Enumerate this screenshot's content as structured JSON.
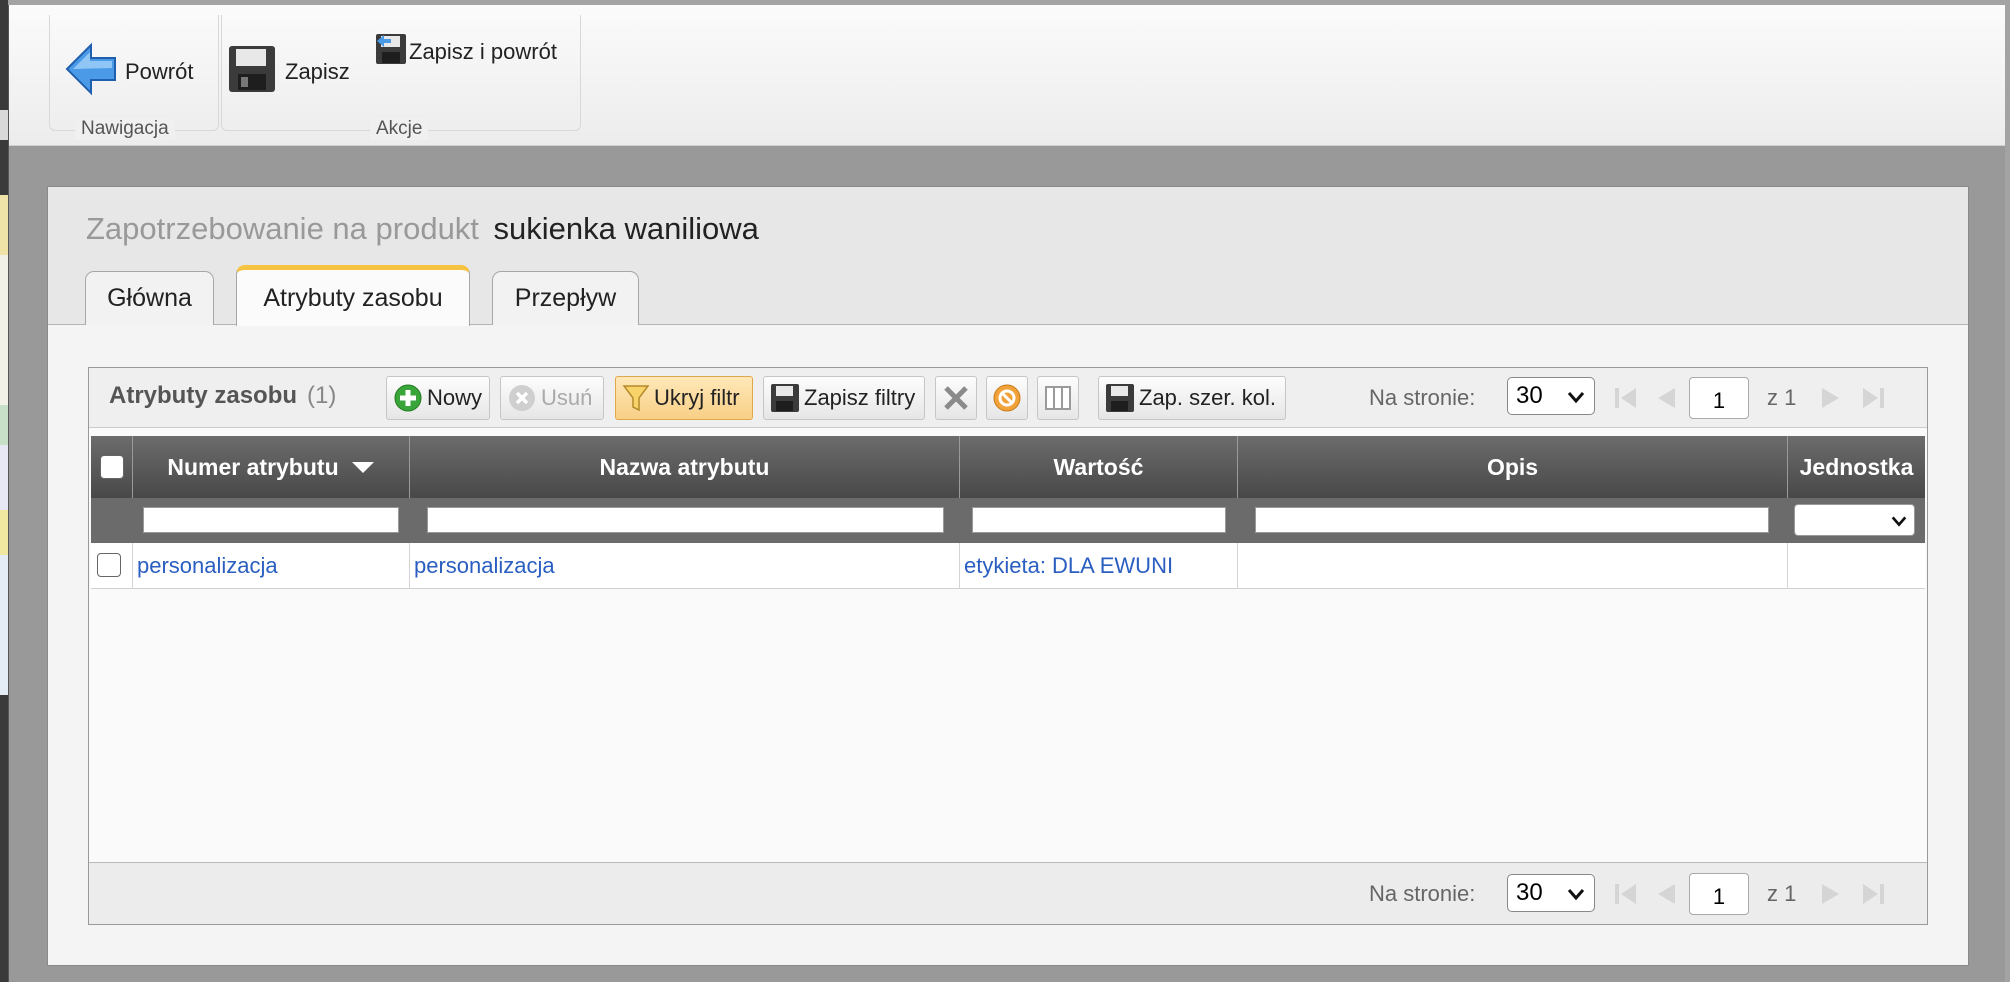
{
  "ribbon": {
    "back_label": "Powrót",
    "save_label": "Zapisz",
    "save_return_label": "Zapisz i powrót",
    "group_navigation": "Nawigacja",
    "group_actions": "Akcje"
  },
  "panel": {
    "title_prefix": "Zapotrzebowanie na produkt",
    "product_name": "sukienka waniliowa",
    "tabs": [
      {
        "label": "Główna",
        "active": false
      },
      {
        "label": "Atrybuty zasobu",
        "active": true
      },
      {
        "label": "Przepływ",
        "active": false
      }
    ]
  },
  "grid": {
    "title": "Atrybuty zasobu",
    "count": "(1)",
    "toolbar": {
      "new_label": "Nowy",
      "delete_label": "Usuń",
      "hide_filter_label": "Ukryj filtr",
      "save_filters_label": "Zapisz filtry",
      "save_col_widths_label": "Zap. szer. kol."
    },
    "pager": {
      "per_page_label": "Na stronie:",
      "per_page_value": "30",
      "page_value": "1",
      "of_total": "z 1"
    },
    "columns": [
      "Numer atrybutu",
      "Nazwa atrybutu",
      "Wartość",
      "Opis",
      "Jednostka"
    ],
    "rows": [
      {
        "number": "personalizacja",
        "name": "personalizacja",
        "value": "etykieta: DLA EWUNI",
        "description": "",
        "unit": ""
      }
    ]
  },
  "colors": {
    "accent_tab": "#f6c343",
    "link": "#2a5ec0",
    "header_bg": "#555555"
  }
}
